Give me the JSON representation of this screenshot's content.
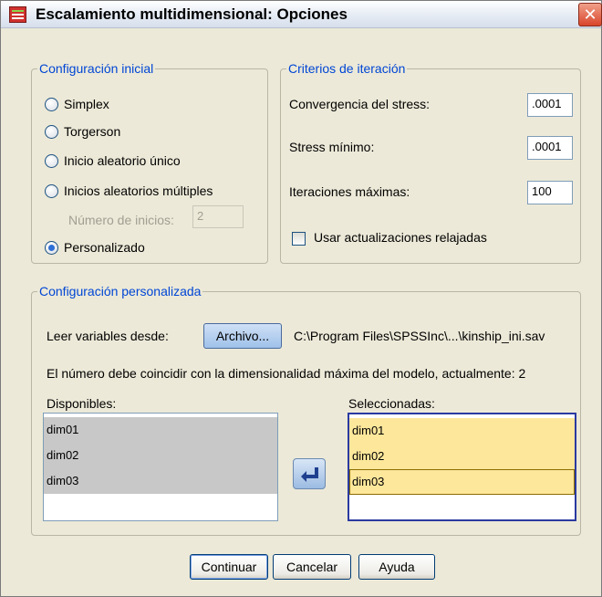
{
  "window": {
    "title": "Escalamiento multidimensional: Opciones",
    "close_symbol": "✕"
  },
  "initial_config": {
    "legend": "Configuración inicial",
    "options": [
      {
        "label": "Simplex",
        "checked": false
      },
      {
        "label": "Torgerson",
        "checked": false
      },
      {
        "label": "Inicio aleatorio único",
        "checked": false
      },
      {
        "label": "Inicios aleatorios múltiples",
        "checked": false
      }
    ],
    "num_starts_label": "Número de inicios:",
    "num_starts_value": "2",
    "custom_option": {
      "label": "Personalizado",
      "checked": true
    }
  },
  "iteration": {
    "legend": "Criterios de iteración",
    "stress_convergence_label": "Convergencia del stress:",
    "stress_convergence_value": ".0001",
    "min_stress_label": "Stress mínimo:",
    "min_stress_value": ".0001",
    "max_iter_label": "Iteraciones máximas:",
    "max_iter_value": "100",
    "relaxed_updates_label": "Usar actualizaciones relajadas",
    "relaxed_updates_checked": false
  },
  "custom_config": {
    "legend": "Configuración personalizada",
    "read_from_label": "Leer variables desde:",
    "file_button": "Archivo...",
    "file_path": "C:\\Program Files\\SPSSInc\\...\\kinship_ini.sav",
    "dimension_note": "El número debe coincidir con la dimensionalidad máxima del modelo, actualmente: 2",
    "available_label": "Disponibles:",
    "available": [
      "dim01",
      "dim02",
      "dim03"
    ],
    "selected_label": "Seleccionadas:",
    "selected": [
      "dim01",
      "dim02",
      "dim03"
    ]
  },
  "buttons": {
    "continue": "Continuar",
    "cancel": "Cancelar",
    "help": "Ayuda"
  },
  "colors": {
    "accent_legend": "#0046d5",
    "selected_item": "#fde79b",
    "available_item": "#c8c8c8"
  }
}
